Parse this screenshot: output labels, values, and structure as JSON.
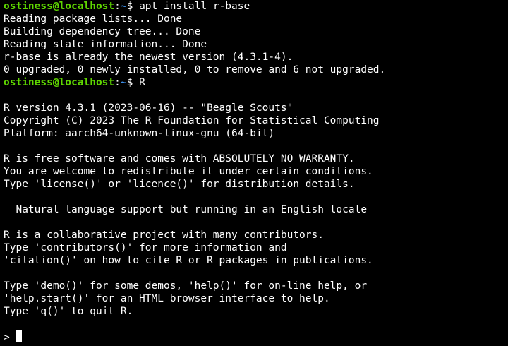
{
  "colors": {
    "background": "#000000",
    "text": "#ffffff",
    "prompt_user": "#5fd700",
    "prompt_path": "#3b8eea"
  },
  "prompt": {
    "user_host": "ostiness@localhost",
    "separator": ":",
    "path": "~",
    "symbol": "$ "
  },
  "commands": [
    "apt install r-base",
    "R"
  ],
  "apt_output": [
    "Reading package lists... Done",
    "Building dependency tree... Done",
    "Reading state information... Done",
    "r-base is already the newest version (4.3.1-4).",
    "0 upgraded, 0 newly installed, 0 to remove and 6 not upgraded."
  ],
  "r_banner": {
    "version": "R version 4.3.1 (2023-06-16) -- \"Beagle Scouts\"",
    "copyright": "Copyright (C) 2023 The R Foundation for Statistical Computing",
    "platform": "Platform: aarch64-unknown-linux-gnu (64-bit)",
    "warranty": [
      "R is free software and comes with ABSOLUTELY NO WARRANTY.",
      "You are welcome to redistribute it under certain conditions.",
      "Type 'license()' or 'licence()' for distribution details."
    ],
    "locale": "  Natural language support but running in an English locale",
    "collab": [
      "R is a collaborative project with many contributors.",
      "Type 'contributors()' for more information and",
      "'citation()' on how to cite R or R packages in publications."
    ],
    "help": [
      "Type 'demo()' for some demos, 'help()' for on-line help, or",
      "'help.start()' for an HTML browser interface to help.",
      "Type 'q()' to quit R."
    ]
  },
  "r_prompt": "> "
}
